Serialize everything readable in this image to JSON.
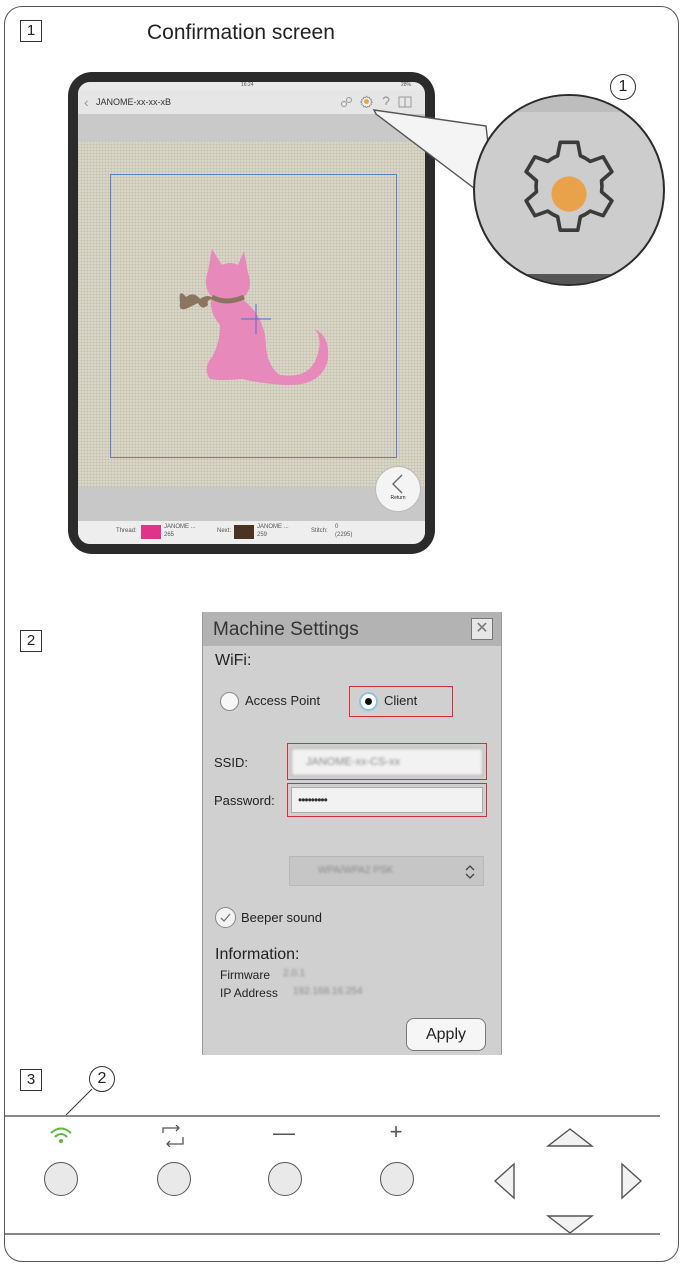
{
  "step1": {
    "number": "1",
    "title": "Confirmation screen",
    "callout": "1"
  },
  "tablet": {
    "status_time": "16:24",
    "status_battery": "28%",
    "nav_title": "JANOME-xx-xx-xB",
    "return_label": "Return",
    "thread_label": "Thread:",
    "thread_name": "JANOME ...",
    "thread_code": "265",
    "thread_color": "#e0338a",
    "next_label": "Next:",
    "next_name": "JANOME ...",
    "next_code": "259",
    "next_color": "#4a3320",
    "stitch_label": "Stitch:",
    "stitch_value": "0",
    "stitch_total": "(2295)"
  },
  "icons": {
    "settings": "gear-icon",
    "back": "chevron-left-icon"
  },
  "step2": {
    "number": "2"
  },
  "machine_settings": {
    "title": "Machine Settings",
    "wifi_label": "WiFi:",
    "mode_access_point": "Access Point",
    "mode_client": "Client",
    "selected_mode": "Client",
    "ssid_label": "SSID:",
    "ssid_value": "JANOME-xx-CS-xx",
    "password_label": "Password:",
    "password_value": "•••••••••",
    "security_value": "WPA/WPA2 PSK",
    "beeper_label": "Beeper sound",
    "beeper_checked": true,
    "info_heading": "Information:",
    "firmware_label": "Firmware",
    "firmware_value": "2.0.1",
    "ip_label": "IP Address",
    "ip_value": "192.168.16.254",
    "apply_label": "Apply"
  },
  "step3": {
    "number": "3",
    "callout": "2"
  },
  "panel": {
    "wifi_led_color": "#5cb83a",
    "buttons": [
      "wifi-button",
      "rotate-button",
      "minus-button",
      "plus-button"
    ],
    "icons": [
      "wifi-icon",
      "rotate-icon",
      "minus-icon",
      "plus-icon"
    ]
  }
}
